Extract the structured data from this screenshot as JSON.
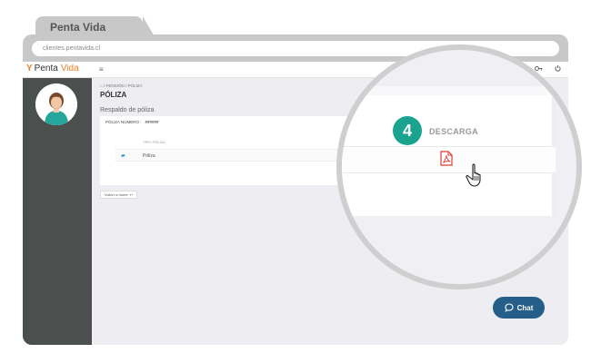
{
  "browser": {
    "tab_title": "Penta Vida",
    "url": "clientes.pentavida.cl"
  },
  "header": {
    "logo_prefix": "Penta",
    "logo_suffix": "Vida",
    "menu_icon": "hamburger-icon",
    "right_icons": [
      "card-icon",
      "key-icon",
      "power-icon"
    ]
  },
  "breadcrumb": "/ PENSIÓN / PÓLIZA",
  "page_title": "PÓLIZA",
  "section_title": "Respaldo de póliza",
  "policy": {
    "number_label": "PÓLIZA NÚMERO :",
    "number_value": "######"
  },
  "table": {
    "column_header": "TIPO PÓLIZA",
    "rows": [
      {
        "type": "Póliza"
      }
    ]
  },
  "back_button": "Volver a home",
  "callout": {
    "step": "4",
    "label": "DESCARGA"
  },
  "chat_label": "Chat",
  "colors": {
    "brand_orange": "#f07e21",
    "sidebar": "#4b4f4d",
    "step_teal": "#1aa38f",
    "chat_blue": "#245e89",
    "pdf_red": "#e53935"
  }
}
